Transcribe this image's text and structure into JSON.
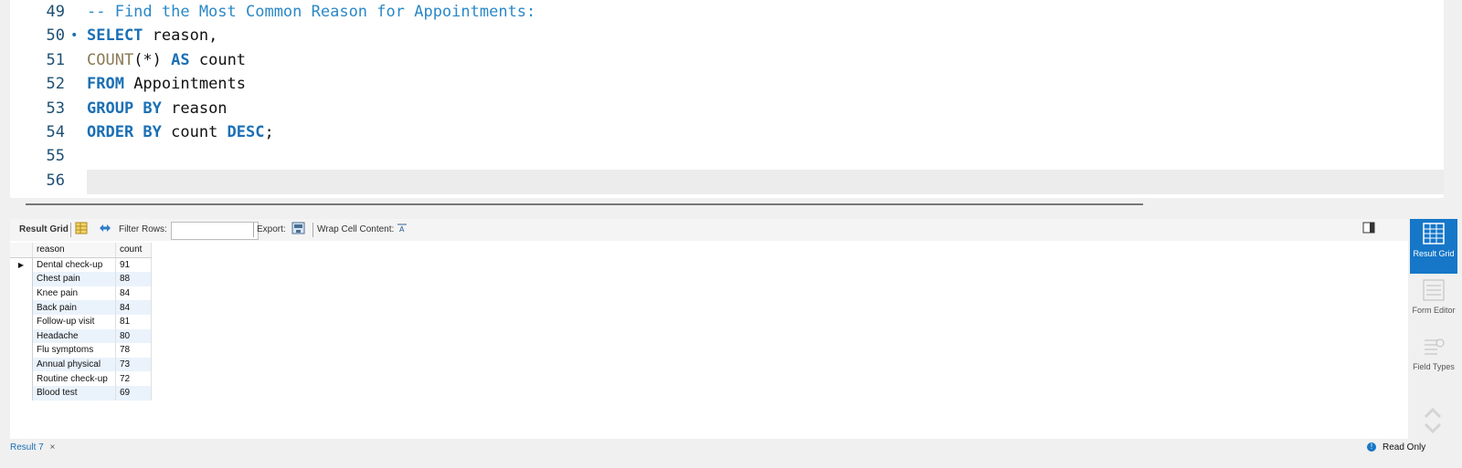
{
  "editor": {
    "lines": [
      {
        "num": "49",
        "marker": "",
        "tokens": [
          {
            "t": "-- Find the Most Common Reason for Appointments:",
            "c": "cm"
          }
        ]
      },
      {
        "num": "50",
        "marker": "•",
        "tokens": [
          {
            "t": "SELECT",
            "c": "kw"
          },
          {
            "t": " reason,",
            "c": "id"
          }
        ]
      },
      {
        "num": "51",
        "marker": "",
        "tokens": [
          {
            "t": "COUNT",
            "c": "fn"
          },
          {
            "t": "(*) ",
            "c": "id"
          },
          {
            "t": "AS",
            "c": "kw"
          },
          {
            "t": " count",
            "c": "id"
          }
        ]
      },
      {
        "num": "52",
        "marker": "",
        "tokens": [
          {
            "t": "FROM",
            "c": "kw"
          },
          {
            "t": " Appointments",
            "c": "id"
          }
        ]
      },
      {
        "num": "53",
        "marker": "",
        "tokens": [
          {
            "t": "GROUP BY",
            "c": "kw"
          },
          {
            "t": " reason",
            "c": "id"
          }
        ]
      },
      {
        "num": "54",
        "marker": "",
        "tokens": [
          {
            "t": "ORDER BY",
            "c": "kw"
          },
          {
            "t": " count ",
            "c": "id"
          },
          {
            "t": "DESC",
            "c": "kw"
          },
          {
            "t": ";",
            "c": "id"
          }
        ]
      },
      {
        "num": "55",
        "marker": "",
        "tokens": []
      },
      {
        "num": "56",
        "marker": "",
        "tokens": []
      }
    ]
  },
  "toolbar": {
    "result_grid": "Result Grid",
    "filter_rows": "Filter Rows:",
    "filter_value": "",
    "export": "Export:",
    "wrap_cell": "Wrap Cell Content:"
  },
  "grid": {
    "columns": [
      "reason",
      "count"
    ],
    "rows": [
      [
        "Dental check-up",
        "91"
      ],
      [
        "Chest pain",
        "88"
      ],
      [
        "Knee pain",
        "84"
      ],
      [
        "Back pain",
        "84"
      ],
      [
        "Follow-up visit",
        "81"
      ],
      [
        "Headache",
        "80"
      ],
      [
        "Flu symptoms",
        "78"
      ],
      [
        "Annual physical",
        "73"
      ],
      [
        "Routine check-up",
        "72"
      ],
      [
        "Blood test",
        "69"
      ]
    ]
  },
  "rail": {
    "result_grid": "Result Grid",
    "form_editor": "Form Editor",
    "field_types": "Field Types"
  },
  "status": {
    "tab_label": "Result 7",
    "tab_close": "×",
    "info_icon": "!",
    "read_only": "Read Only"
  },
  "colors": {
    "accent": "#1677c8",
    "keyword": "#1a6fb5",
    "comment": "#2b88c6"
  }
}
